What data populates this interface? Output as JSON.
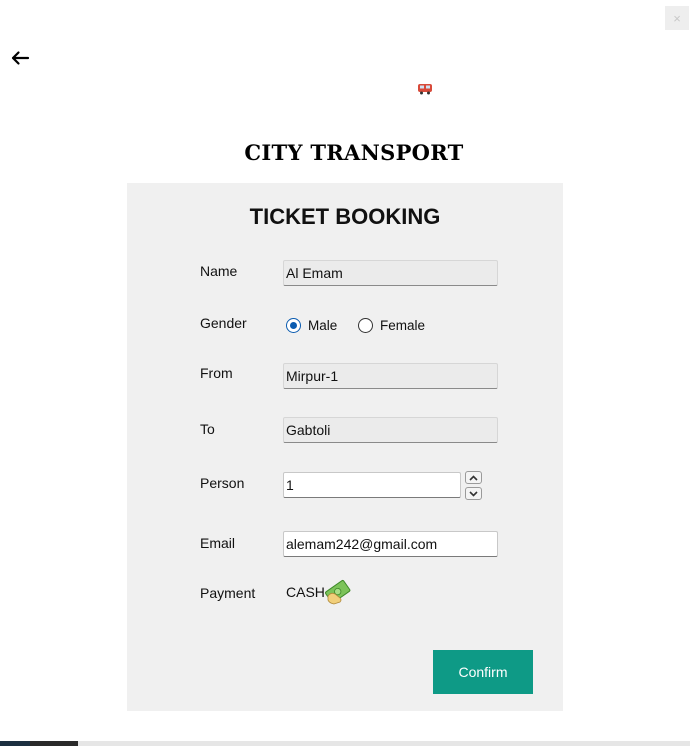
{
  "window": {
    "close_label": "×"
  },
  "header": {
    "brand": "CITY TRANSPORT"
  },
  "form": {
    "title": "TICKET BOOKING",
    "name_label": "Name",
    "name_value": "Al Emam",
    "gender_label": "Gender",
    "gender_options": [
      "Male",
      "Female"
    ],
    "gender_selected": "Male",
    "from_label": "From",
    "from_value": "Mirpur-1",
    "to_label": "To",
    "to_value": "Gabtoli",
    "person_label": "Person",
    "person_value": "1",
    "email_label": "Email",
    "email_value": "alemam242@gmail.com",
    "payment_label": "Payment",
    "payment_value": "CASH",
    "confirm_label": "Confirm"
  },
  "icons": [
    "back-arrow-icon",
    "bus-icon",
    "money-icon",
    "chevron-up-icon",
    "chevron-down-icon"
  ],
  "colors": {
    "confirm": "#0e9a86",
    "radio_selected": "#0a5bb0",
    "panel": "#f0f0f0"
  }
}
